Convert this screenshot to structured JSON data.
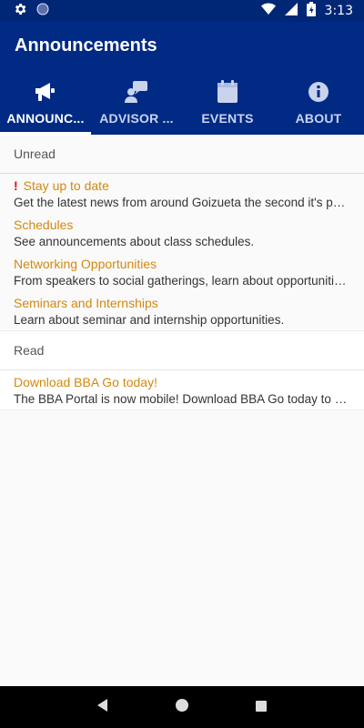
{
  "status": {
    "time": "3:13",
    "battery": "+"
  },
  "appbar": {
    "title": "Announcements"
  },
  "tabs": [
    {
      "label": "ANNOUNC...",
      "icon": "megaphone-icon",
      "active": true
    },
    {
      "label": "ADVISOR ...",
      "icon": "advisor-icon",
      "active": false
    },
    {
      "label": "EVENTS",
      "icon": "calendar-icon",
      "active": false
    },
    {
      "label": "ABOUT",
      "icon": "info-icon",
      "active": false
    }
  ],
  "sections": {
    "unread": {
      "header": "Unread",
      "items": [
        {
          "icon": "exclamation-icon",
          "title": "Stay up to date",
          "body": "Get the latest news from around Goizueta the second it's posted."
        },
        {
          "title": "Schedules",
          "body": "See announcements about class schedules."
        },
        {
          "title": "Networking Opportunities",
          "body": "From speakers to social gatherings, learn about opportunities to network."
        },
        {
          "title": "Seminars and Internships",
          "body": "Learn about seminar and internship opportunities."
        }
      ]
    },
    "read": {
      "header": "Read",
      "items": [
        {
          "title": "Download BBA Go today!",
          "body": "The BBA Portal is now mobile! Download BBA Go today to get started."
        }
      ]
    }
  },
  "colors": {
    "primary": "#002a84",
    "accent": "#d4880f"
  }
}
